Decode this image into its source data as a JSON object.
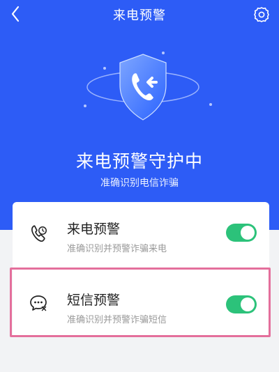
{
  "header": {
    "title": "来电预警"
  },
  "hero": {
    "title": "来电预警守护中",
    "subtitle": "准确识别电信诈骗"
  },
  "features": [
    {
      "title": "来电预警",
      "subtitle": "准确识别并预警诈骗来电",
      "enabled": true
    },
    {
      "title": "短信预警",
      "subtitle": "准确识别并预警诈骗短信",
      "enabled": true
    }
  ],
  "colors": {
    "primary": "#2d5cf6",
    "toggle_on": "#2cc27a",
    "highlight": "#e46f9c"
  },
  "icons": {
    "back": "back-arrow-icon",
    "settings": "gear-icon",
    "shield": "shield-phone-icon",
    "call": "phone-call-icon",
    "sms": "chat-bubble-icon"
  }
}
